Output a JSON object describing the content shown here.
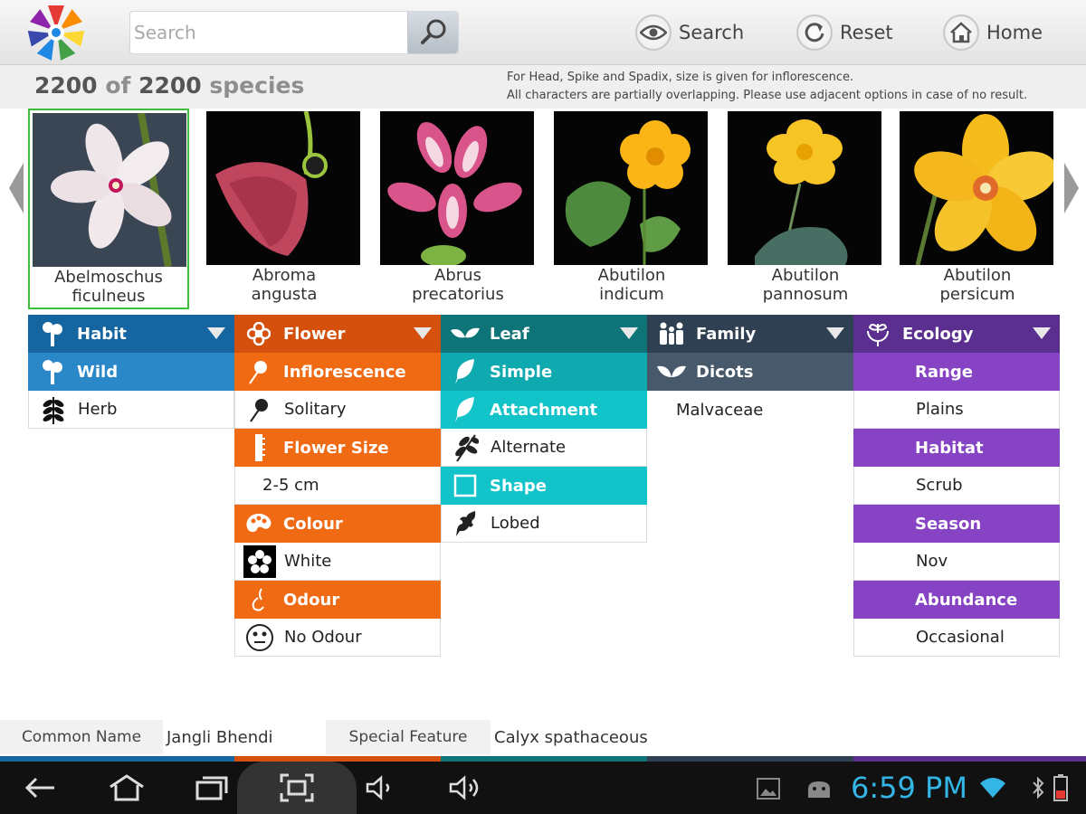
{
  "search": {
    "placeholder": "Search"
  },
  "top_buttons": {
    "search": "Search",
    "reset": "Reset",
    "home": "Home"
  },
  "count": {
    "shown": "2200",
    "of": "of",
    "total": "2200",
    "unit": "species"
  },
  "notes": [
    "For Head, Spike and Spadix, size is given for inflorescence.",
    "All characters are partially overlapping. Please use adjacent options in case of no result."
  ],
  "species": [
    {
      "line1": "Abelmoschus",
      "line2": "ficulneus",
      "selected": true
    },
    {
      "line1": "Abroma",
      "line2": "angusta"
    },
    {
      "line1": "Abrus",
      "line2": "precatorius"
    },
    {
      "line1": "Abutilon",
      "line2": "indicum"
    },
    {
      "line1": "Abutilon",
      "line2": "pannosum"
    },
    {
      "line1": "Abutilon",
      "line2": "persicum"
    }
  ],
  "colors": {
    "habit_head": "#1565a0",
    "habit_sub": "#2a87c8",
    "flower_head": "#d4500c",
    "flower_sub": "#f06a14",
    "leaf_head": "#0f7478",
    "leaf_sub": "#0eaab0",
    "leaf_sub2": "#12c3c9",
    "family_head": "#2f4052",
    "family_sub": "#47596b",
    "ecology_head": "#5b2f8f",
    "ecology_sub": "#8643c4"
  },
  "columns": {
    "habit": {
      "header": "Habit",
      "rows": [
        {
          "type": "sub",
          "label": "Wild"
        },
        {
          "type": "val",
          "label": "Herb"
        }
      ]
    },
    "flower": {
      "header": "Flower",
      "rows": [
        {
          "type": "sub",
          "label": "Inflorescence"
        },
        {
          "type": "val",
          "label": "Solitary"
        },
        {
          "type": "sub",
          "label": "Flower Size"
        },
        {
          "type": "val",
          "label": "2-5 cm"
        },
        {
          "type": "sub",
          "label": "Colour"
        },
        {
          "type": "val",
          "label": "White"
        },
        {
          "type": "sub",
          "label": "Odour"
        },
        {
          "type": "val",
          "label": "No Odour"
        }
      ]
    },
    "leaf": {
      "header": "Leaf",
      "rows": [
        {
          "type": "sub",
          "label": "Simple"
        },
        {
          "type": "sub",
          "label": "Attachment"
        },
        {
          "type": "val",
          "label": "Alternate"
        },
        {
          "type": "sub",
          "label": "Shape"
        },
        {
          "type": "val",
          "label": "Lobed"
        }
      ]
    },
    "family": {
      "header": "Family",
      "rows": [
        {
          "type": "sub",
          "label": "Dicots"
        },
        {
          "type": "val",
          "label": "Malvaceae"
        }
      ]
    },
    "ecology": {
      "header": "Ecology",
      "rows": [
        {
          "type": "sub",
          "label": "Range"
        },
        {
          "type": "val",
          "label": "Plains"
        },
        {
          "type": "sub",
          "label": "Habitat"
        },
        {
          "type": "val",
          "label": "Scrub"
        },
        {
          "type": "sub",
          "label": "Season"
        },
        {
          "type": "val",
          "label": "Nov"
        },
        {
          "type": "sub",
          "label": "Abundance"
        },
        {
          "type": "val",
          "label": "Occasional"
        }
      ]
    }
  },
  "info": {
    "common_name_label": "Common Name",
    "common_name": "Jangli Bhendi",
    "special_feature_label": "Special Feature",
    "special_feature": "Calyx spathaceous"
  },
  "status": {
    "time": "6:59 PM"
  }
}
